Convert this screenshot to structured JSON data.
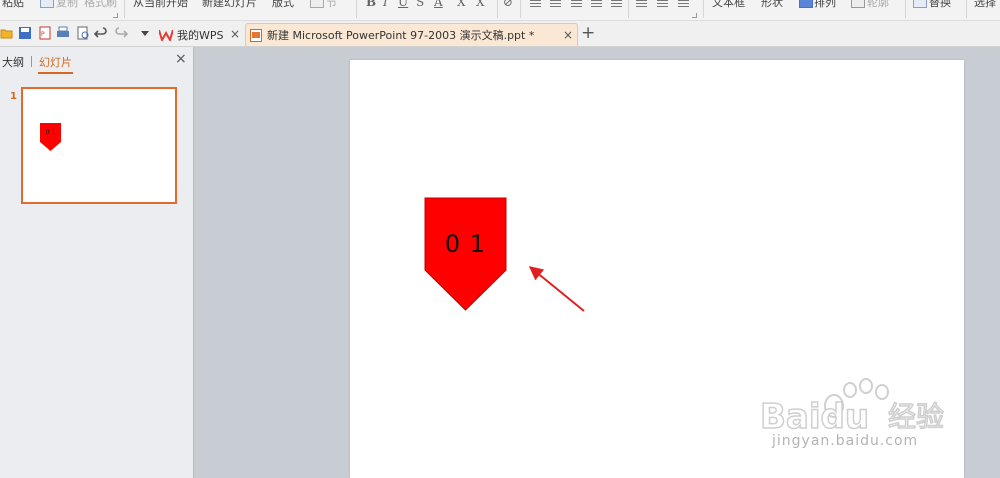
{
  "ribbon": {
    "paste": "粘贴",
    "copy": "复制",
    "format_painter": "格式刷",
    "from_current": "从当前开始",
    "new_slide": "新建幻灯片",
    "layout": "版式",
    "section": "节",
    "text_box": "文本框",
    "shapes": "形状",
    "arrange": "排列",
    "outline": "轮廓",
    "replace": "替换",
    "select": "选择"
  },
  "tabs": {
    "home_label": "我的WPS",
    "doc_label": "新建 Microsoft PowerPoint 97-2003 演示文稿.ppt *",
    "close_glyph": "×",
    "add_glyph": "+"
  },
  "pane": {
    "outline_tab": "大纲",
    "slides_tab": "幻灯片",
    "close_glyph": "×",
    "slide_number": "1"
  },
  "slide": {
    "shape_text": "0 1",
    "shape_color": "#ff0000",
    "arrow_color": "#e02020"
  },
  "watermark": {
    "brand": "Baidu",
    "cn": "经验",
    "url": "jingyan.baidu.com"
  },
  "colors": {
    "accent": "#d2691e",
    "thumb_border": "#e06b2c",
    "doc_tab_bg": "#fbe8d4"
  }
}
